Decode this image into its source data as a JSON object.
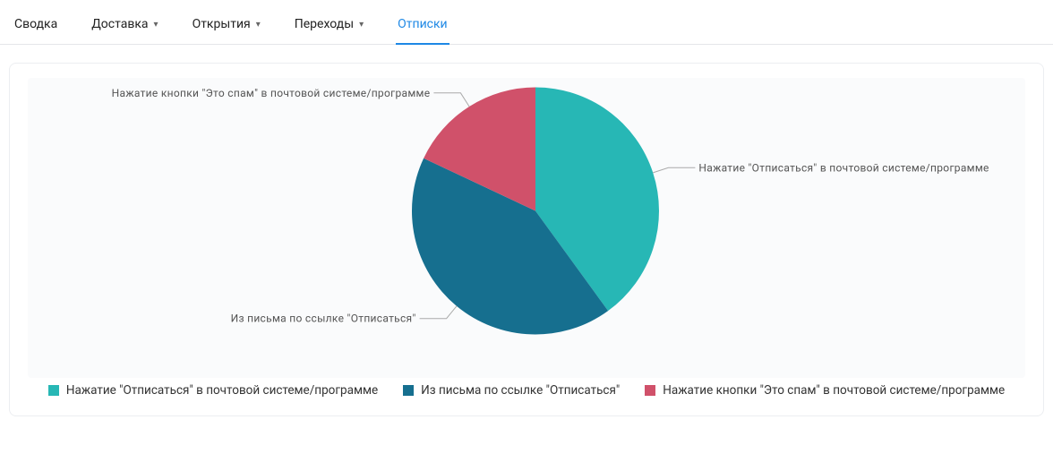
{
  "tabs": {
    "summary": "Сводка",
    "delivery": "Доставка",
    "opens": "Открытия",
    "clicks": "Переходы",
    "unsubs": "Отписки",
    "active": "unsubs"
  },
  "chart_data": {
    "type": "pie",
    "title": "",
    "slices": [
      {
        "label": "Нажатие \"Отписаться\" в почтовой системе/программе",
        "value": 40,
        "color": "#27b7b5"
      },
      {
        "label": "Из письма по ссылке \"Отписаться\"",
        "value": 42,
        "color": "#166f8f"
      },
      {
        "label": "Нажатие кнопки \"Это спам\" в почтовой системе/программе",
        "value": 18,
        "color": "#d0516a"
      }
    ],
    "callouts": [
      {
        "slice": 0,
        "text": "Нажатие \"Отписаться\" в почтовой системе/программе"
      },
      {
        "slice": 1,
        "text": "Из письма по ссылке \"Отписаться\""
      },
      {
        "slice": 2,
        "text": "Нажатие кнопки \"Это спам\" в почтовой системе/программе"
      }
    ]
  },
  "legend": [
    {
      "label": "Нажатие \"Отписаться\" в почтовой системе/программе",
      "color": "#27b7b5"
    },
    {
      "label": "Из письма по ссылке \"Отписаться\"",
      "color": "#166f8f"
    },
    {
      "label": "Нажатие кнопки \"Это спам\" в почтовой системе/программе",
      "color": "#d0516a"
    }
  ]
}
